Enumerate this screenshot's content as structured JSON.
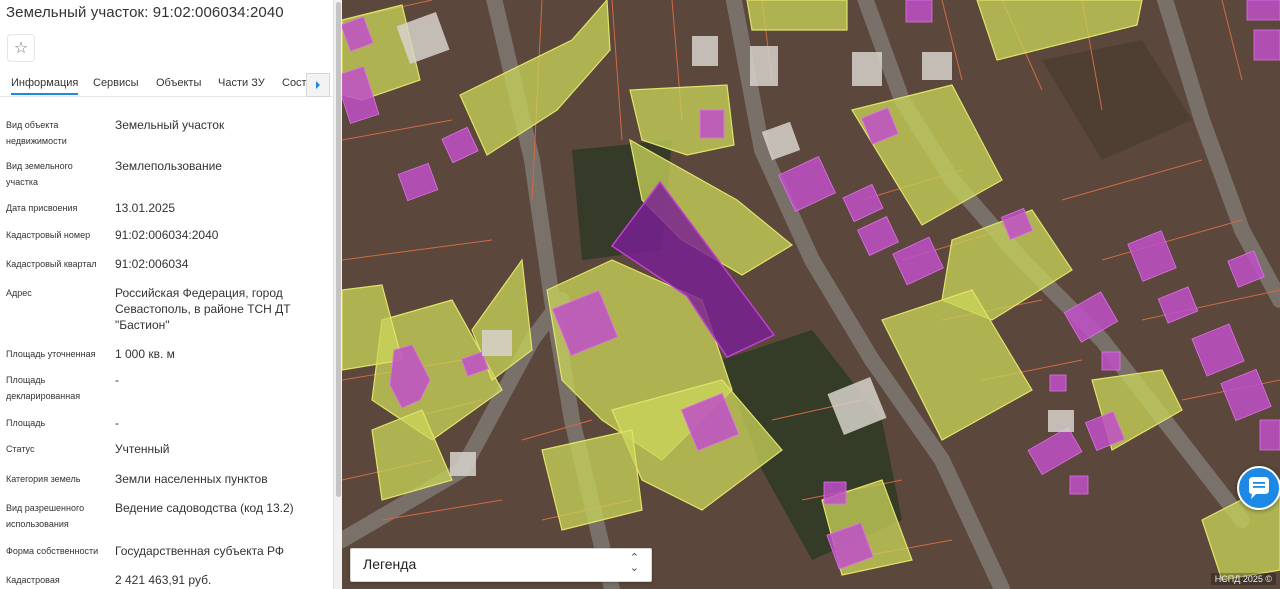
{
  "panel": {
    "title": "Земельный участок: 91:02:006034:2040",
    "tabs": [
      "Информация",
      "Сервисы",
      "Объекты",
      "Части ЗУ",
      "Соста"
    ],
    "fields": [
      {
        "label": "Вид объекта недвижимости",
        "value": "Земельный участок"
      },
      {
        "label": "Вид земельного участка",
        "value": "Землепользование"
      },
      {
        "label": "Дата присвоения",
        "value": "13.01.2025"
      },
      {
        "label": "Кадастровый номер",
        "value": "91:02:006034:2040"
      },
      {
        "label": "Кадастровый квартал",
        "value": "91:02:006034"
      },
      {
        "label": "Адрес",
        "value": "Российская Федерация, город Севастополь, в районе ТСН ДТ \"Бастион\""
      },
      {
        "label": "Площадь уточненная",
        "value": "1 000 кв. м"
      },
      {
        "label": "Площадь декларированная",
        "value": "-"
      },
      {
        "label": "Площадь",
        "value": "-"
      },
      {
        "label": "Статус",
        "value": "Учтенный"
      },
      {
        "label": "Категория земель",
        "value": "Земли населенных пунктов"
      },
      {
        "label": "Вид разрешенного использования",
        "value": "Ведение садоводства (код 13.2)"
      },
      {
        "label": "Форма собственности",
        "value": "Государственная субъекта РФ"
      },
      {
        "label": "Кадастровая",
        "value": "2 421 463,91 руб."
      }
    ]
  },
  "map": {
    "legend_label": "Легенда",
    "copyright": "НСПД 2025 ©",
    "colors": {
      "parcel_fill": "#c9d65a",
      "parcel_border": "#e3e36a",
      "building": "#c050c8",
      "selected": "#7a1f95",
      "boundary": "#d06a45"
    },
    "icons": [
      "star-icon",
      "chevron-right-icon",
      "unfold-icon",
      "chat-icon"
    ]
  }
}
